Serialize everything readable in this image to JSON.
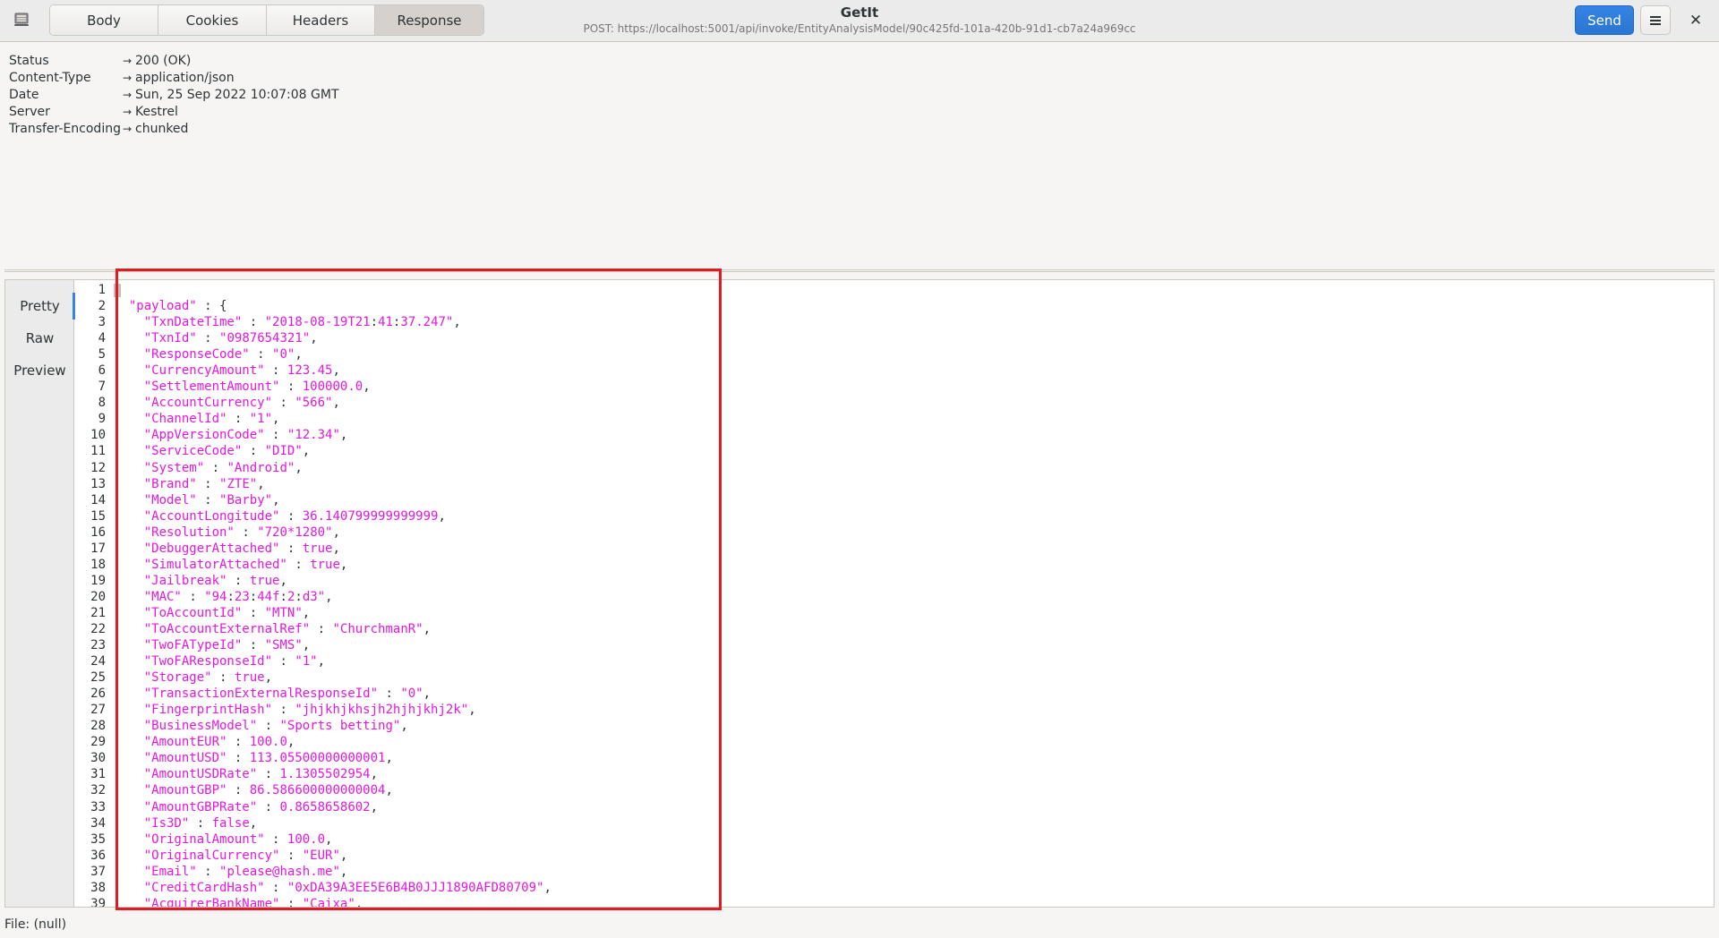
{
  "header": {
    "tabs": [
      {
        "label": "Body",
        "active": false
      },
      {
        "label": "Cookies",
        "active": false
      },
      {
        "label": "Headers",
        "active": false
      },
      {
        "label": "Response",
        "active": true
      }
    ],
    "title": "GetIt",
    "subtitle": "POST: https://localhost:5001/api/invoke/EntityAnalysisModel/90c425fd-101a-420b-91d1-cb7a24a969cc",
    "send_label": "Send",
    "menu_icon": "hamburger-icon",
    "close_label": "✕"
  },
  "response_headers": [
    {
      "key": "Status",
      "value": "200 (OK)"
    },
    {
      "key": "Content-Type",
      "value": "application/json"
    },
    {
      "key": "Date",
      "value": "Sun, 25 Sep 2022 10:07:08 GMT"
    },
    {
      "key": "Server",
      "value": "Kestrel"
    },
    {
      "key": "Transfer-Encoding",
      "value": "chunked"
    }
  ],
  "viewer": {
    "modes": [
      {
        "label": "Pretty",
        "active": true
      },
      {
        "label": "Raw",
        "active": false
      },
      {
        "label": "Preview",
        "active": false
      }
    ],
    "lines": [
      "{",
      "  \"payload\" : {",
      "    \"TxnDateTime\" : \"2018-08-19T21:41:37.247\",",
      "    \"TxnId\" : \"0987654321\",",
      "    \"ResponseCode\" : \"0\",",
      "    \"CurrencyAmount\" : 123.45,",
      "    \"SettlementAmount\" : 100000.0,",
      "    \"AccountCurrency\" : \"566\",",
      "    \"ChannelId\" : \"1\",",
      "    \"AppVersionCode\" : \"12.34\",",
      "    \"ServiceCode\" : \"DID\",",
      "    \"System\" : \"Android\",",
      "    \"Brand\" : \"ZTE\",",
      "    \"Model\" : \"Barby\",",
      "    \"AccountLongitude\" : 36.140799999999999,",
      "    \"Resolution\" : \"720*1280\",",
      "    \"DebuggerAttached\" : true,",
      "    \"SimulatorAttached\" : true,",
      "    \"Jailbreak\" : true,",
      "    \"MAC\" : \"94:23:44f:2:d3\",",
      "    \"ToAccountId\" : \"MTN\",",
      "    \"ToAccountExternalRef\" : \"ChurchmanR\",",
      "    \"TwoFATypeId\" : \"SMS\",",
      "    \"TwoFAResponseId\" : \"1\",",
      "    \"Storage\" : true,",
      "    \"TransactionExternalResponseId\" : \"0\",",
      "    \"FingerprintHash\" : \"jhjkhjkhsjh2hjhjkhj2k\",",
      "    \"BusinessModel\" : \"Sports betting\",",
      "    \"AmountEUR\" : 100.0,",
      "    \"AmountUSD\" : 113.05500000000001,",
      "    \"AmountUSDRate\" : 1.1305502954,",
      "    \"AmountGBP\" : 86.586600000000004,",
      "    \"AmountGBPRate\" : 0.8658658602,",
      "    \"Is3D\" : false,",
      "    \"OriginalAmount\" : 100.0,",
      "    \"OriginalCurrency\" : \"EUR\",",
      "    \"Email\" : \"please@hash.me\",",
      "    \"CreditCardHash\" : \"0xDA39A3EE5E6B4B0JJJ1890AFD80709\",",
      "    \"AcquirerBankName\" : \"Caixa\","
    ]
  },
  "status_bar": "File: (null)",
  "colors": {
    "accent": "#3584e4",
    "highlight_box": "#e01b24",
    "json_token": "#e617e0"
  }
}
